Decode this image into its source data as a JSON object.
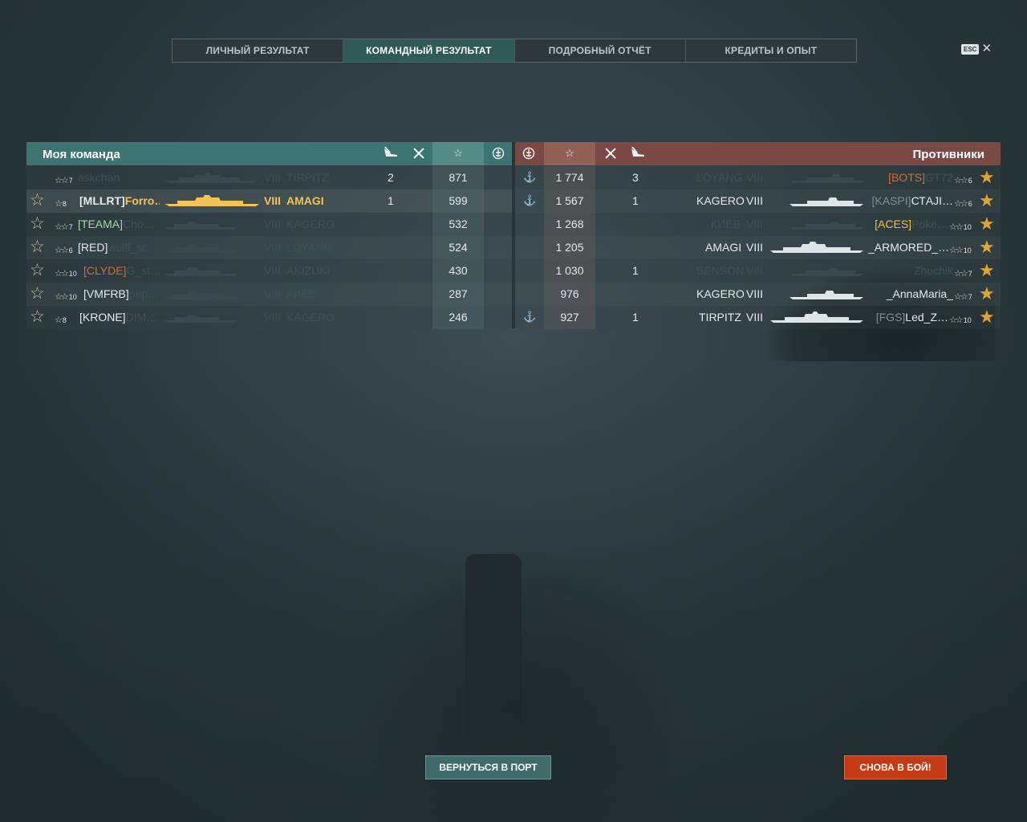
{
  "tabs": [
    {
      "label": "ЛИЧНЫЙ РЕЗУЛЬТАТ"
    },
    {
      "label": "КОМАНДНЫЙ РЕЗУЛЬТАТ"
    },
    {
      "label": "ПОДРОБНЫЙ ОТЧЁТ"
    },
    {
      "label": "КРЕДИТЫ И ОПЫТ"
    }
  ],
  "active_tab": 1,
  "esc": {
    "key": "ESC",
    "close": "✕"
  },
  "my_team": {
    "title": "Моя команда",
    "icons": {
      "ships_killed": "torpedo-kill-icon",
      "planes": "planes-destroyed-icon",
      "xp": "☆",
      "capture": "capture-icon"
    },
    "rows": [
      {
        "clan": "",
        "name": "askchan",
        "rank": "7",
        "tier": "VIII",
        "ship": "TIRPITZ",
        "kills": "2",
        "xp": "871",
        "style": "dim",
        "star": false
      },
      {
        "clan": "[MLLRT]",
        "name": "Forro…",
        "rank": "8",
        "tier": "VIII",
        "ship": "AMAGI",
        "kills": "1",
        "xp": "599",
        "style": "me",
        "star": true
      },
      {
        "clan": "[TEAMA]",
        "name": "Cho…",
        "rank": "7",
        "tier": "VIII",
        "ship": "KAGERO",
        "kills": "",
        "xp": "532",
        "style": "dim",
        "star": true
      },
      {
        "clan": "[RED]",
        "name": "wulff_st…",
        "rank": "6",
        "tier": "VIII",
        "ship": "LOYANG",
        "kills": "",
        "xp": "524",
        "style": "dim",
        "star": true
      },
      {
        "clan": "[CLYDE]",
        "name": "G_st…",
        "rank": "10",
        "tier": "VIII",
        "ship": "AKIZUKI",
        "kills": "",
        "xp": "430",
        "style": "dim",
        "star": true
      },
      {
        "clan": "[VMFRB]",
        "name": "pep…",
        "rank": "10",
        "tier": "VIII",
        "ship": "КИЕВ",
        "kills": "",
        "xp": "287",
        "style": "dim",
        "star": true
      },
      {
        "clan": "[KRONE]",
        "name": "DIM…",
        "rank": "8",
        "tier": "VIII",
        "ship": "KAGERO",
        "kills": "",
        "xp": "246",
        "style": "dim",
        "star": true
      }
    ]
  },
  "enemy_team": {
    "title": "Противники",
    "rows": [
      {
        "clan": "[BOTS]",
        "name": "GT72",
        "rank": "6",
        "tier": "VIII",
        "ship": "LOYANG",
        "kills": "3",
        "xp": "1 774",
        "capture": true,
        "style": "dim"
      },
      {
        "clan": "[KASPI]",
        "name": "СТAJI…",
        "rank": "6",
        "tier": "VIII",
        "ship": "KAGERO",
        "kills": "1",
        "xp": "1 567",
        "capture": true,
        "style": "bright"
      },
      {
        "clan": "[ACES]",
        "name": "Poke…",
        "rank": "10",
        "tier": "VIII",
        "ship": "КИЕВ",
        "kills": "",
        "xp": "1 268",
        "capture": false,
        "style": "dim"
      },
      {
        "clan": "",
        "name": "_ARMORED_…",
        "rank": "10",
        "tier": "VIII",
        "ship": "AMAGI",
        "kills": "",
        "xp": "1 205",
        "capture": false,
        "style": "bright"
      },
      {
        "clan": "",
        "name": "Zhuchik",
        "rank": "7",
        "tier": "VIII",
        "ship": "BENSON",
        "kills": "1",
        "xp": "1 030",
        "capture": false,
        "style": "dim"
      },
      {
        "clan": "",
        "name": "_AnnaMaria_",
        "rank": "7",
        "tier": "VIII",
        "ship": "KAGERO",
        "kills": "",
        "xp": "976",
        "capture": false,
        "style": "bright"
      },
      {
        "clan": "[FGS]",
        "name": "Led_Z…",
        "rank": "10",
        "tier": "VIII",
        "ship": "TIRPITZ",
        "kills": "1",
        "xp": "927",
        "capture": true,
        "style": "bright"
      }
    ]
  },
  "buttons": {
    "return_port": "ВЕРНУТЬСЯ В ПОРТ",
    "battle_again": "СНОВА В БОЙ!"
  },
  "colors": {
    "my_team_header": "#3b7470",
    "enemy_header": "#7a4943",
    "player_highlight": "#f2c35a",
    "battle_button": "#c43a14"
  }
}
